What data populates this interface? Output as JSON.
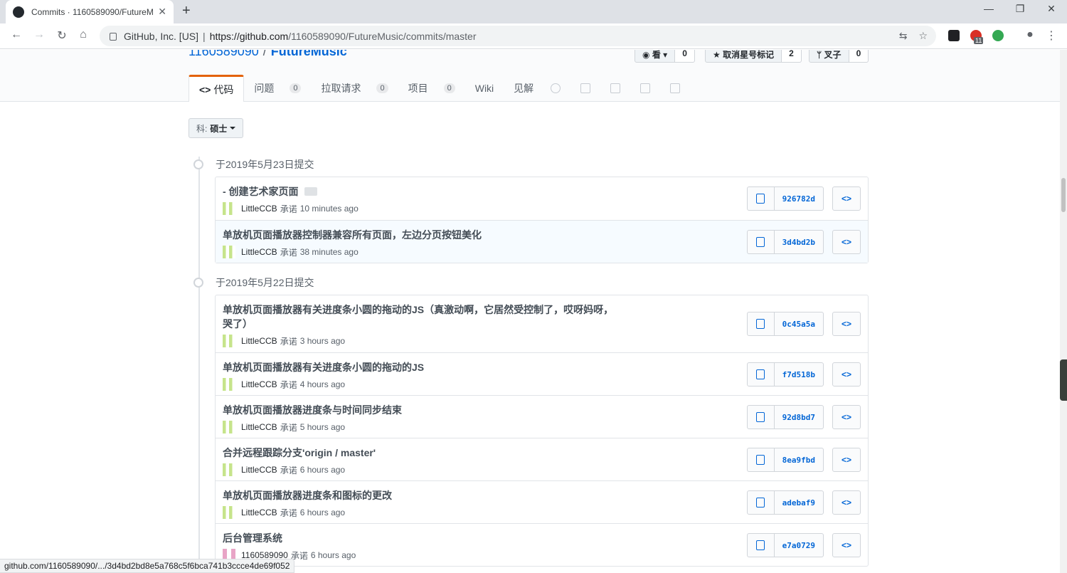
{
  "browser": {
    "tab_title": "Commits · 1160589090/FutureM",
    "omnibox_site": "GitHub, Inc. [US]",
    "omnibox_sep": "|",
    "url_host": "https://github.com",
    "url_path": "/1160589090/FutureMusic/commits/master",
    "ext_badge": "11",
    "status_url": "github.com/1160589090/.../3d4bd2bd8e5a768c5f6bca741b3ccce4de69f052"
  },
  "repo": {
    "owner": "1160589090",
    "slash": "/",
    "name": "FutureMusic",
    "watch_label": "看",
    "watch_count": "0",
    "star_label": "取消星号标记",
    "star_count": "2",
    "fork_label": "叉子",
    "fork_count": "0"
  },
  "nav": {
    "code": "代码",
    "issues": "问题",
    "issues_count": "0",
    "pulls": "拉取请求",
    "pulls_count": "0",
    "projects": "项目",
    "projects_count": "0",
    "wiki": "Wiki",
    "insights": "见解"
  },
  "branch": {
    "key": "科:",
    "value": "硕士"
  },
  "groups": [
    {
      "date": "于2019年5月23日提交",
      "commits": [
        {
          "message": "- 创建艺术家页面",
          "author": "LittleCCB",
          "verb": "承诺",
          "time": "10 minutes ago",
          "sha": "926782d"
        },
        {
          "message": "单放机页面播放器控制器兼容所有页面，左边分页按钮美化",
          "author": "LittleCCB",
          "verb": "承诺",
          "time": "38 minutes ago",
          "sha": "3d4bd2b"
        }
      ]
    },
    {
      "date": "于2019年5月22日提交",
      "commits": [
        {
          "message": "单放机页面播放器有关进度条小圆的拖动的JS（真激动啊，它居然受控制了，哎呀妈呀，哭了）",
          "author": "LittleCCB",
          "verb": "承诺",
          "time": "3 hours ago",
          "sha": "0c45a5a"
        },
        {
          "message": "单放机页面播放器有关进度条小圆的拖动的JS",
          "author": "LittleCCB",
          "verb": "承诺",
          "time": "4 hours ago",
          "sha": "f7d518b"
        },
        {
          "message": "单放机页面播放器进度条与时间同步结束",
          "author": "LittleCCB",
          "verb": "承诺",
          "time": "5 hours ago",
          "sha": "92d8bd7"
        },
        {
          "message": "合并远程跟踪分支'origin / master'",
          "author": "LittleCCB",
          "verb": "承诺",
          "time": "6 hours ago",
          "sha": "8ea9fbd"
        },
        {
          "message": "单放机页面播放器进度条和图标的更改",
          "author": "LittleCCB",
          "verb": "承诺",
          "time": "6 hours ago",
          "sha": "adebaf9"
        },
        {
          "message": "后台管理系统",
          "author": "1160589090",
          "verb": "承诺",
          "time": "6 hours ago",
          "sha": "e7a0729"
        }
      ]
    }
  ],
  "colors": {
    "link": "#0366d6",
    "accent_tab": "#e36209",
    "highlight_row": "#f6fbff"
  }
}
